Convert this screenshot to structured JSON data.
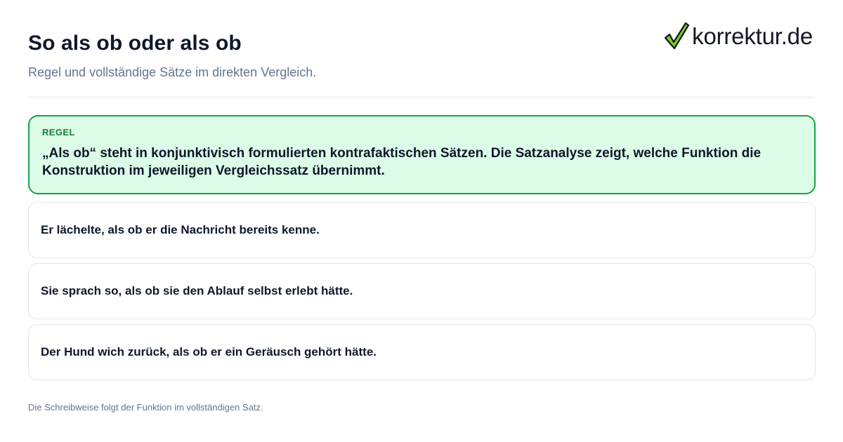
{
  "header": {
    "title": "So als ob oder als ob",
    "subtitle": "Regel und vollständige Sätze im direkten Vergleich.",
    "logo_text": "korrektur.de"
  },
  "rule": {
    "label": "REGEL",
    "text": "„Als ob“ steht in konjunktivisch formulierten kontrafaktischen Sätzen. Die Satzanalyse zeigt, welche Funktion die Konstruktion im jeweiligen Vergleichssatz übernimmt."
  },
  "examples": [
    "Er lächelte, als ob er die Nachricht bereits kenne.",
    "Sie sprach so, als ob sie den Ablauf selbst erlebt hätte.",
    "Der Hund wich zurück, als ob er ein Geräusch gehört hätte."
  ],
  "footer": "Die Schreibweise folgt der Funktion im vollständigen Satz.",
  "colors": {
    "rule_background": "#dcfce7",
    "rule_border": "#16a34a",
    "rule_label": "#15803d",
    "checkmark": "#84cc16"
  },
  "icons": {
    "logo": "checkmark-icon"
  }
}
